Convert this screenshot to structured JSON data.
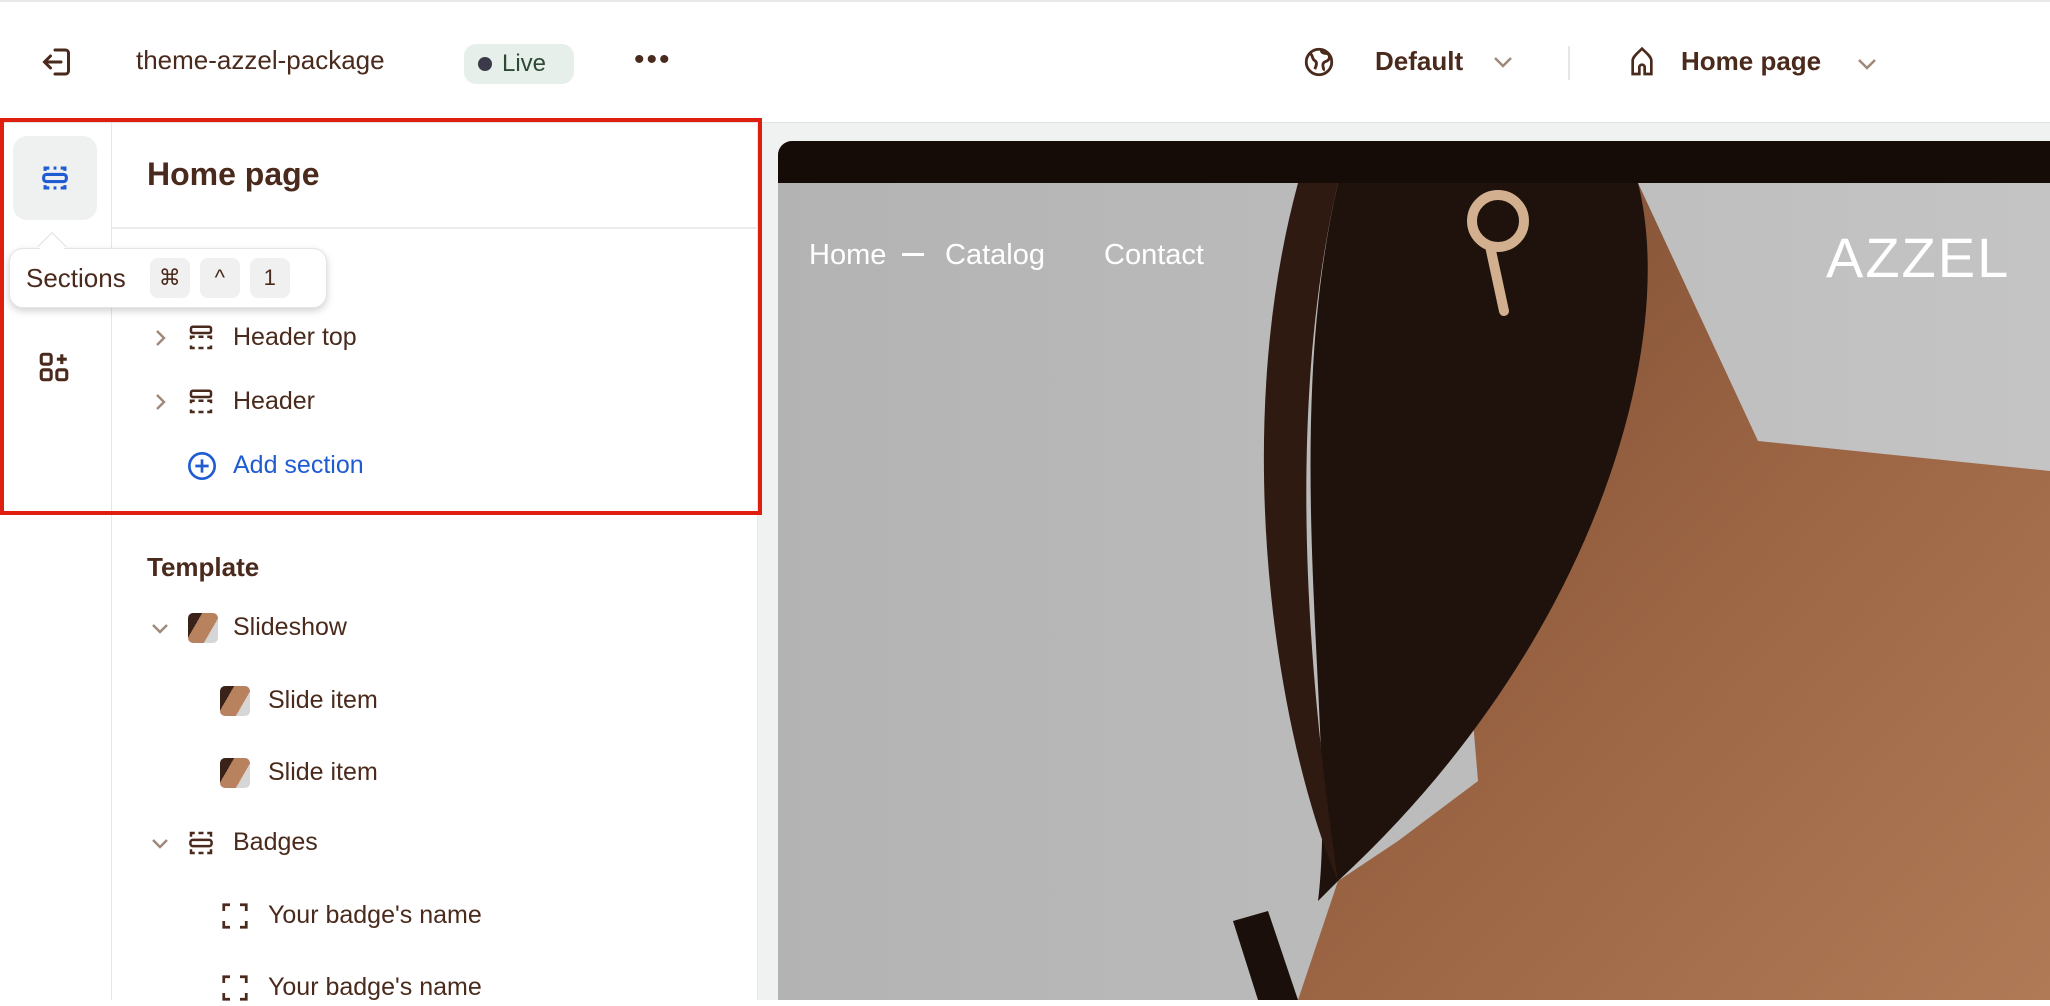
{
  "topbar": {
    "exit_icon": "exit-icon",
    "theme_name": "theme-azzel-package",
    "status_badge": "Live",
    "more_icon": "more-horizontal-icon",
    "language": {
      "icon": "globe-icon",
      "label": "Default"
    },
    "page_selector": {
      "icon": "home-icon",
      "label": "Home page"
    }
  },
  "rail": {
    "items": [
      {
        "icon": "sections-icon",
        "active": true
      },
      {
        "icon": "add-apps-icon",
        "active": false
      }
    ]
  },
  "tooltip": {
    "label": "Sections",
    "shortcut": [
      "⌘",
      "^",
      "1"
    ]
  },
  "panel": {
    "title": "Home page",
    "header_group": {
      "items": [
        {
          "label": "Header top",
          "icon": "section-icon"
        },
        {
          "label": "Header",
          "icon": "section-icon"
        }
      ],
      "add_section": "Add section"
    },
    "template": {
      "heading": "Template",
      "items": [
        {
          "label": "Slideshow",
          "icon": "image-thumbnail",
          "expanded": true,
          "children": [
            {
              "label": "Slide item"
            },
            {
              "label": "Slide item"
            }
          ]
        },
        {
          "label": "Badges",
          "icon": "section-icon",
          "expanded": true,
          "children": [
            {
              "label": "Your badge's name"
            },
            {
              "label": "Your badge's name"
            }
          ]
        }
      ]
    }
  },
  "preview": {
    "nav": [
      "Home",
      "Catalog",
      "Contact"
    ],
    "logo": "AZZEL"
  },
  "colors": {
    "text": "#4a2a1c",
    "accent": "#1f5bd1",
    "highlight": "#e01e10",
    "live_badge": "#e6efe9"
  }
}
